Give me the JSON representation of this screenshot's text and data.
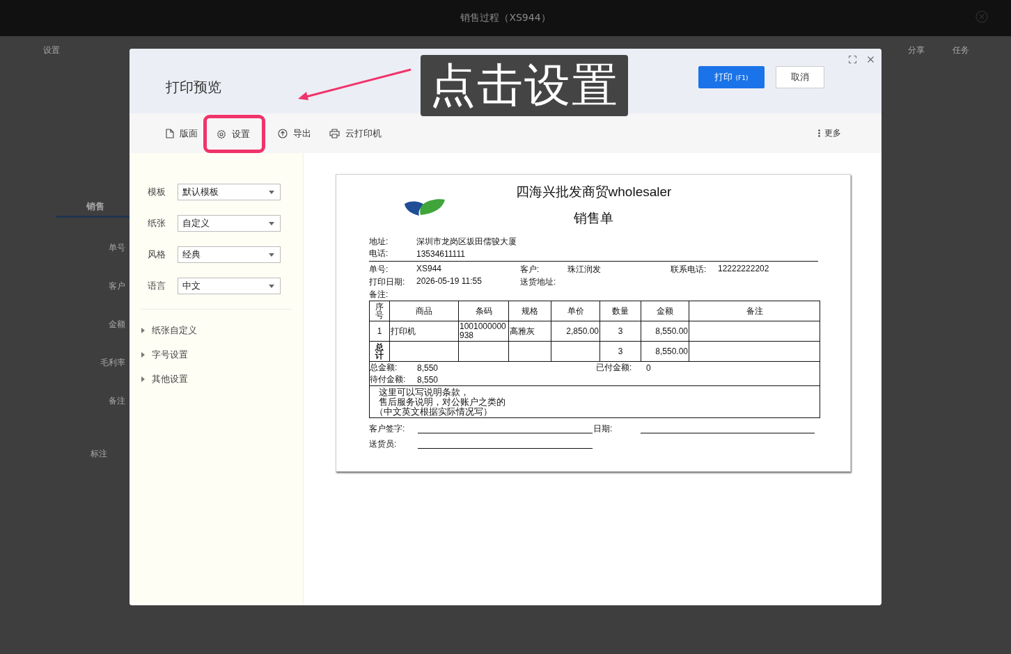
{
  "app": {
    "title": "销售过程（XS944）",
    "toolbar_left": [
      {
        "label": "设置"
      }
    ],
    "toolbar_right": [
      {
        "label": "分享"
      },
      {
        "label": "任务"
      }
    ],
    "tab": "销售",
    "field_labels": [
      "单号",
      "客户",
      "金额",
      "毛利率",
      "备注"
    ],
    "column_label": "标注"
  },
  "dialog": {
    "title": "打印预览",
    "buttons": [
      {
        "kind": "primary",
        "label": "打印",
        "shortcut": "(F1)"
      },
      {
        "kind": "default",
        "label": "取消"
      }
    ],
    "toolbar": [
      {
        "kind": "page",
        "label": "版面",
        "highlighted": false
      },
      {
        "kind": "gear",
        "label": "设置",
        "highlighted": true
      },
      {
        "kind": "upload",
        "label": "导出",
        "highlighted": false
      },
      {
        "kind": "printer",
        "label": "云打印机",
        "highlighted": false
      }
    ],
    "more": "更多",
    "settings": [
      {
        "label": "模板",
        "value": "默认模板"
      },
      {
        "label": "纸张",
        "value": "自定义"
      },
      {
        "label": "风格",
        "value": "经典"
      },
      {
        "label": "语言",
        "value": "中文"
      }
    ],
    "sections": [
      {
        "label": "纸张自定义",
        "expanded": false
      },
      {
        "label": "字号设置",
        "expanded": false
      },
      {
        "label": "其他设置",
        "expanded": false
      }
    ]
  },
  "annotation": {
    "text": "点击设置"
  },
  "document": {
    "company": "四海兴批发商贸wholesaler",
    "title": "销售单",
    "contact": [
      {
        "label": "地址:",
        "value": "深圳市龙岗区坂田儒骏大厦"
      },
      {
        "label": "电话:",
        "value": "13534611111"
      }
    ],
    "info_rows": [
      [
        {
          "label": "单号:",
          "value": "XS944"
        },
        {
          "label": "客户:",
          "value": "珠江润发"
        },
        {
          "label": "联系电话:",
          "value": "12222222202"
        }
      ],
      [
        {
          "label": "打印日期:",
          "value": "2026-05-19 11:55"
        },
        {
          "label": "送货地址:"
        }
      ],
      [
        {
          "label": "备注:"
        }
      ]
    ],
    "columns": [
      "序号",
      "商品",
      "条码",
      "规格",
      "单价",
      "数量",
      "金额",
      "备注"
    ],
    "rows": [
      [
        "1",
        "打印机",
        "1001000000938",
        "高雅灰",
        "2,850.00",
        "3",
        "8,550.00"
      ]
    ],
    "total": {
      "label": "总计",
      "quantity": "3",
      "amount": "8,550.00"
    },
    "summary": [
      {
        "label": "总金额:",
        "value": "8,550"
      },
      {
        "label": "已付金额:",
        "value": "0"
      },
      {
        "label": "待付金额:",
        "value": "8,550"
      }
    ],
    "notes": [
      "这里可以写说明条款，",
      "售后服务说明，对公账户之类的",
      "（中文英文根据实际情况写）"
    ],
    "signatures": [
      {
        "label": "客户签字:"
      },
      {
        "label": "日期:"
      },
      {
        "label": "送货员:"
      }
    ]
  }
}
